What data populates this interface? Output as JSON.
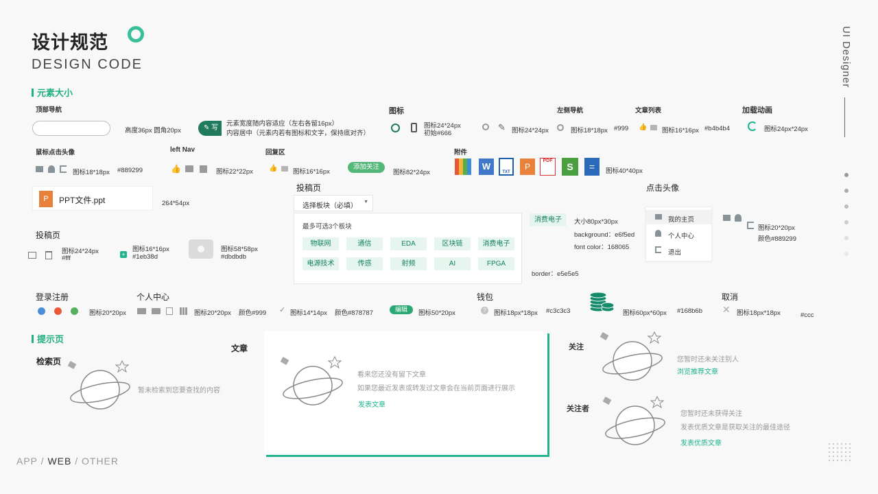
{
  "header": {
    "title": "设计规范",
    "subtitle": "DESIGN CODE"
  },
  "side": {
    "vertical_label": "UI Designer"
  },
  "footer": {
    "app": "APP",
    "sep": "/",
    "web": "WEB",
    "other": "OTHER"
  },
  "colors": {
    "brand": "#1eb38d",
    "green": "#22b07d",
    "tag_bg": "#e6f5ed",
    "tag_text": "#168065",
    "icon_gray": "#999",
    "border": "#e5e5e5"
  },
  "section_element": {
    "title": "元素大小",
    "top_nav": {
      "label": "顶部导航",
      "spec": "高度36px 圆角20px",
      "button_label": "写",
      "desc1": "元素宽度随内容适应（左右各留16px）",
      "desc2": "内容居中（元素内若有图标和文字，保持底对齐）"
    },
    "icons": {
      "label": "图标",
      "spec1": "图标24*24px",
      "spec2": "初始#666",
      "spec3": "图标24*24px"
    },
    "left_guide": {
      "label": "左侧导航",
      "spec": "图标18*18px",
      "color": "#999"
    },
    "article_list": {
      "label": "文章列表",
      "spec": "图标16*16px",
      "color": "#b4b4b4"
    },
    "loading": {
      "label": "加载动画",
      "spec": "图标24px*24px"
    },
    "mouse_avatar": {
      "label": "鼠标点击头像",
      "spec": "图标18*18px",
      "color": "#889299"
    },
    "left_nav": {
      "label": "left Nav",
      "spec": "图标22*22px"
    },
    "reply": {
      "label": "回复区",
      "spec": "图标16*16px",
      "button": "添加关注",
      "button_spec": "图标82*24px"
    },
    "attachment": {
      "label": "附件",
      "spec": "图标40*40px",
      "icons": [
        "RAR",
        "W",
        "TXT",
        "P",
        "PDF",
        "S",
        "="
      ]
    },
    "ppt_file": {
      "name": "PPT文件.ppt",
      "icon": "P",
      "spec": "264*54px"
    },
    "submit_page": {
      "label": "投稿页",
      "select_placeholder": "选择板块（必填）",
      "hint": "最多可选3个板块",
      "tags": [
        "物联网",
        "通信",
        "EDA",
        "区块链",
        "消费电子",
        "电源技术",
        "传感",
        "射频",
        "AI",
        "FPGA"
      ]
    },
    "tag_spec": {
      "tag": "消费电子",
      "size": "大小80px*30px",
      "background": "background：e6f5ed",
      "font_color": "font color：168065",
      "border": "border：e5e5e5"
    },
    "avatar_click": {
      "label": "点击头像",
      "menu": [
        "我的主页",
        "个人中心",
        "退出"
      ],
      "spec": "图标20*20px",
      "color": "颜色#889299"
    },
    "submit_left": {
      "label": "投稿页",
      "spec1a": "图标24*24px",
      "spec1b": "#fff",
      "spec2a": "图标16*16px",
      "spec2b": "#1eb38d",
      "spec3a": "图标58*58px",
      "spec3b": "#dbdbdb"
    },
    "login": {
      "label": "登录注册",
      "spec": "图标20*20px"
    },
    "personal": {
      "label": "个人中心",
      "spec": "图标20*20px",
      "color": "颜色#999",
      "spec2": "图标14*14px",
      "color2": "颜色#878787",
      "button": "编辑",
      "button_spec": "图标50*20px"
    },
    "wallet": {
      "label": "钱包",
      "spec": "图标18px*18px",
      "color": "#c3c3c3",
      "spec2": "图标60px*60px",
      "color2": "#168b6b"
    },
    "cancel": {
      "label": "取消",
      "spec": "图标18px*18px",
      "color": "#ccc"
    }
  },
  "section_tips": {
    "title": "提示页",
    "search": {
      "label": "检索页",
      "msg": "暂未检索到您要查找的内容"
    },
    "article": {
      "label": "文章",
      "msg1": "看来您还没有留下文章",
      "msg2": "如果您最近发表或转发过文章会在当前页面进行展示",
      "link": "发表文章"
    },
    "follow": {
      "label": "关注",
      "msg": "您暂时还未关注别人",
      "link": "浏览推荐文章"
    },
    "follower": {
      "label": "关注者",
      "msg1": "您暂时还未获得关注",
      "msg2": "发表优质文章是获取关注的最佳途径",
      "link": "发表优质文章"
    }
  }
}
